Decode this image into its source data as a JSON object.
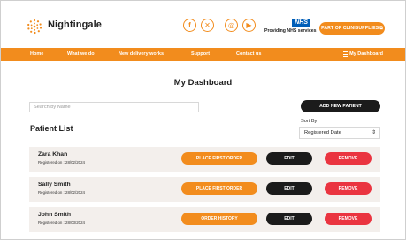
{
  "header": {
    "brand": "Nightingale",
    "social_icons": [
      "facebook-icon",
      "x-icon",
      "instagram-icon",
      "youtube-icon"
    ],
    "nhs_logo": "NHS",
    "nhs_text": "Providing NHS services",
    "part_of_label": "PART OF CLINISUPPLIES",
    "accent_color": "#f28c1d"
  },
  "nav": {
    "items": [
      "Home",
      "What we do",
      "New delivery works",
      "Support",
      "Contact us"
    ],
    "dashboard_label": "My Dashboard"
  },
  "main": {
    "title": "My Dashboard",
    "search_placeholder": "Search by Name",
    "add_patient_label": "ADD NEW PATIENT",
    "list_title": "Patient List",
    "sort_label": "Sort By",
    "sort_value": "Registered Date"
  },
  "patients": [
    {
      "name": "Zara Khan",
      "registered": "Registered on : 28/02/2024",
      "order_label": "PLACE FIRST ORDER",
      "edit_label": "EDIT",
      "remove_label": "REMOVE"
    },
    {
      "name": "Sally Smith",
      "registered": "Registered on : 28/02/2024",
      "order_label": "PLACE FIRST ORDER",
      "edit_label": "EDIT",
      "remove_label": "REMOVE"
    },
    {
      "name": "John Smith",
      "registered": "Registered on : 28/03/2024",
      "order_label": "ORDER HISTORY",
      "edit_label": "EDIT",
      "remove_label": "REMOVE"
    }
  ]
}
